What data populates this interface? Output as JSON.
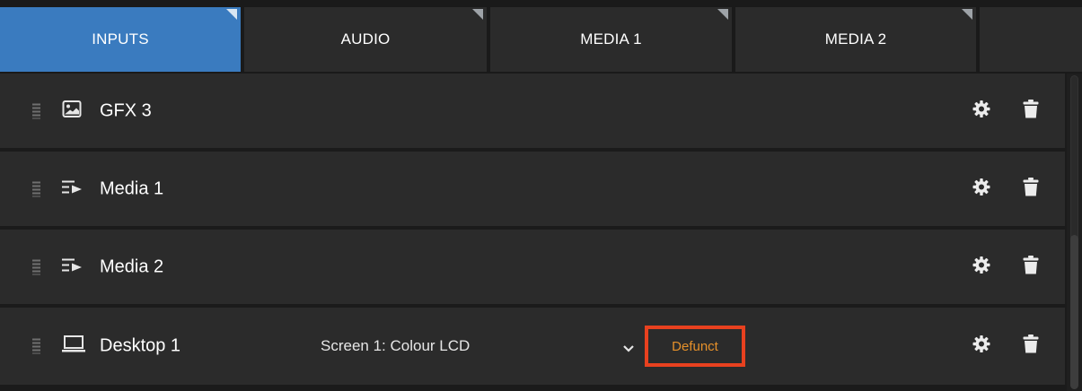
{
  "tabs": [
    {
      "label": "INPUTS",
      "active": true
    },
    {
      "label": "AUDIO",
      "active": false
    },
    {
      "label": "MEDIA 1",
      "active": false
    },
    {
      "label": "MEDIA 2",
      "active": false
    }
  ],
  "rows": [
    {
      "label": "GFX 3",
      "icon": "image-icon"
    },
    {
      "label": "Media 1",
      "icon": "playlist-icon"
    },
    {
      "label": "Media 2",
      "icon": "playlist-icon"
    },
    {
      "label": "Desktop 1",
      "icon": "laptop-icon",
      "screen": "Screen 1: Colour LCD",
      "status": "Defunct"
    }
  ],
  "colors": {
    "accent": "#3a7bbf",
    "row_bg": "#2b2b2b",
    "status_text": "#e5902a",
    "highlight_box": "#e8411f"
  }
}
